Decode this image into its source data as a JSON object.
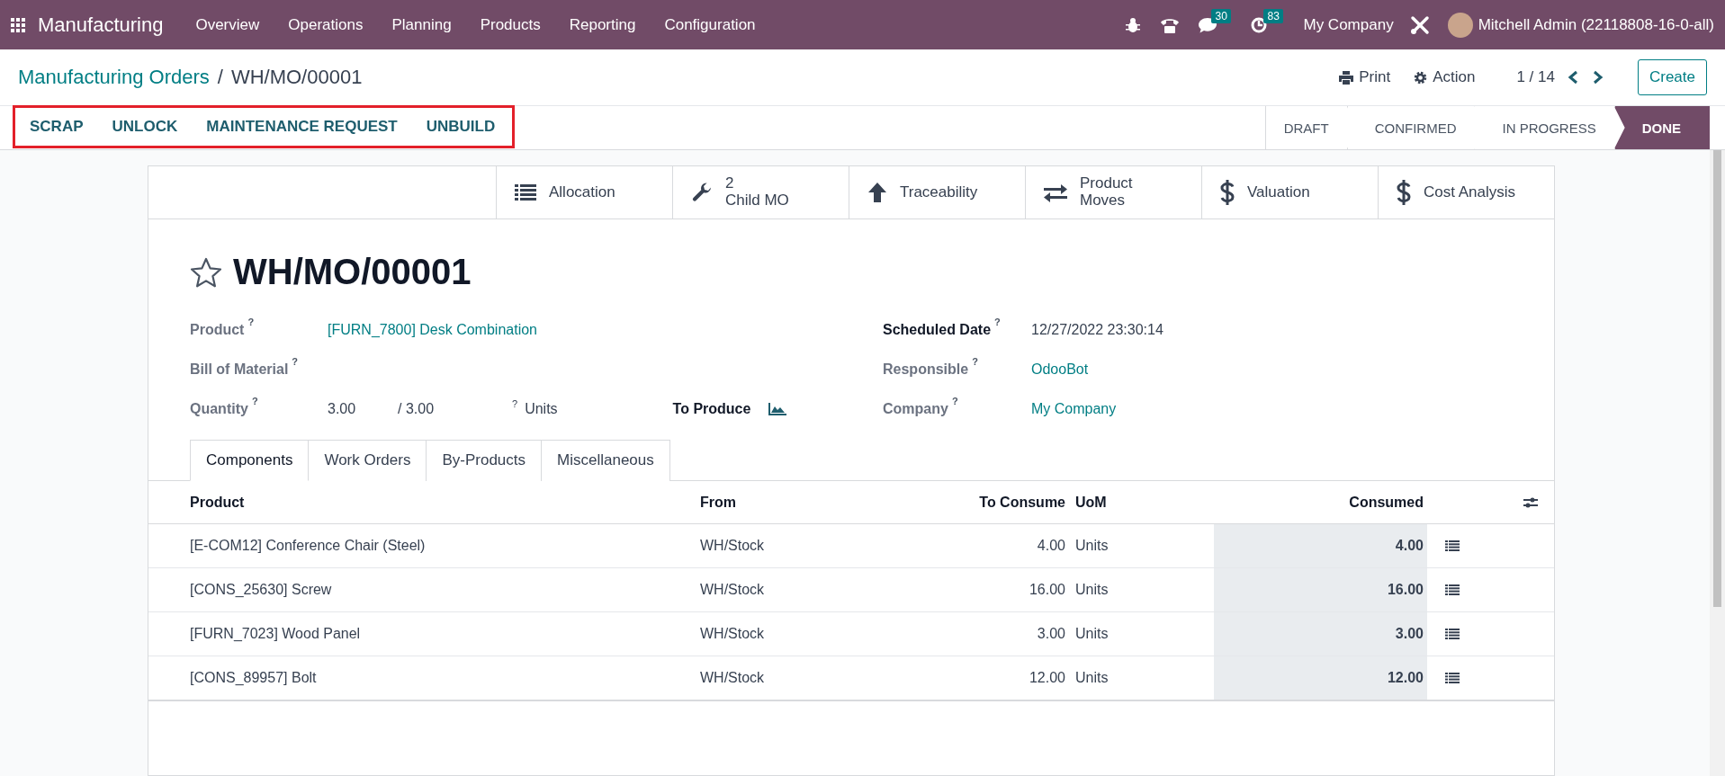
{
  "navbar": {
    "app_name": "Manufacturing",
    "menu": [
      "Overview",
      "Operations",
      "Planning",
      "Products",
      "Reporting",
      "Configuration"
    ],
    "messages_badge": "30",
    "activities_badge": "83",
    "company": "My Company",
    "user": "Mitchell Admin (22118808-16-0-all)"
  },
  "breadcrumb": {
    "parent": "Manufacturing Orders",
    "separator": "/",
    "current": "WH/MO/00001"
  },
  "actions": {
    "print": "Print",
    "action": "Action",
    "pager": "1 / 14",
    "create": "Create"
  },
  "header_buttons": [
    "SCRAP",
    "UNLOCK",
    "MAINTENANCE REQUEST",
    "UNBUILD"
  ],
  "stages": [
    {
      "label": "DRAFT",
      "selected": false
    },
    {
      "label": "CONFIRMED",
      "selected": false
    },
    {
      "label": "IN PROGRESS",
      "selected": false
    },
    {
      "label": "DONE",
      "selected": true
    }
  ],
  "stat_buttons": [
    {
      "kind": "list",
      "label": "Allocation"
    },
    {
      "kind": "wrench",
      "count": "2",
      "label": "Child MO"
    },
    {
      "kind": "arrow",
      "label": "Traceability"
    },
    {
      "kind": "exchange",
      "label": "Product\nMoves"
    },
    {
      "kind": "dollar",
      "label": "Valuation"
    },
    {
      "kind": "dollar",
      "label": "Cost Analysis"
    }
  ],
  "title": {
    "name": "WH/MO/00001",
    "starred": false
  },
  "fields_left": [
    {
      "label": "Product",
      "help": "?",
      "value": "[FURN_7800] Desk Combination",
      "link": true
    },
    {
      "label": "Bill of Material",
      "help": "?"
    },
    {
      "label": "Quantity",
      "help": "?",
      "value": "3.00",
      "produced": "/ 3.00",
      "uom_help": "?",
      "uom": "Units",
      "to_produce": "To Produce"
    }
  ],
  "fields_right": [
    {
      "label": "Scheduled Date",
      "help": "?",
      "value": "12/27/2022 23:30:14",
      "link": false,
      "bold": true
    },
    {
      "label": "Responsible",
      "help": "?",
      "value": "OdooBot",
      "link": true,
      "bold": false
    },
    {
      "label": "Company",
      "help": "?",
      "value": "My Company",
      "link": true,
      "bold": false
    }
  ],
  "tabs": [
    {
      "label": "Components",
      "selected": true
    },
    {
      "label": "Work Orders",
      "selected": false
    },
    {
      "label": "By-Products",
      "selected": false
    },
    {
      "label": "Miscellaneous",
      "selected": false
    }
  ],
  "table": {
    "columns": [
      "Product",
      "From",
      "To Consume",
      "UoM",
      "Consumed"
    ],
    "rows": [
      {
        "product": "[E-COM12] Conference Chair (Steel)",
        "from": "WH/Stock",
        "to_consume": "4.00",
        "uom": "Units",
        "consumed": "4.00"
      },
      {
        "product": "[CONS_25630] Screw",
        "from": "WH/Stock",
        "to_consume": "16.00",
        "uom": "Units",
        "consumed": "16.00"
      },
      {
        "product": "[FURN_7023] Wood Panel",
        "from": "WH/Stock",
        "to_consume": "3.00",
        "uom": "Units",
        "consumed": "3.00"
      },
      {
        "product": "[CONS_89957] Bolt",
        "from": "WH/Stock",
        "to_consume": "12.00",
        "uom": "Units",
        "consumed": "12.00"
      }
    ]
  }
}
